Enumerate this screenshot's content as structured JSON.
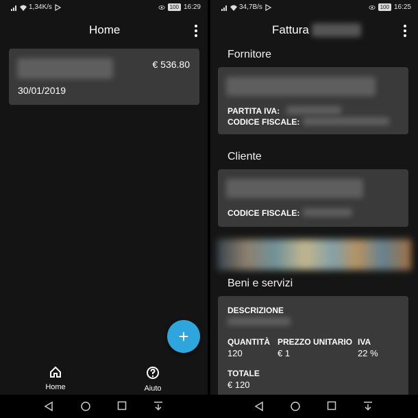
{
  "left": {
    "status": {
      "speed": "1,34K/s",
      "battery": "100",
      "time": "16:29"
    },
    "appbar": {
      "title": "Home"
    },
    "invoice": {
      "amount": "€ 536.80",
      "date": "30/01/2019"
    },
    "fab": {
      "label": "+"
    },
    "nav": {
      "home_label": "Home",
      "help_label": "Aiuto"
    }
  },
  "right": {
    "status": {
      "speed": "34,7B/s",
      "battery": "100",
      "time": "16:25"
    },
    "appbar": {
      "title": "Fattura"
    },
    "supplier": {
      "section_title": "Fornitore",
      "vat_label": "PARTITA IVA:",
      "tax_code_label": "CODICE FISCALE:"
    },
    "client": {
      "section_title": "Cliente",
      "tax_code_label": "CODICE FISCALE:"
    },
    "goods": {
      "section_title": "Beni e servizi",
      "description_label": "DESCRIZIONE",
      "quantity_label": "QUANTITÀ",
      "quantity_value": "120",
      "unit_price_label": "PREZZO UNITARIO",
      "unit_price_value": "€ 1",
      "vat_label": "IVA",
      "vat_value": "22 %",
      "total_label": "TOTALE",
      "total_value": "€ 120"
    }
  }
}
